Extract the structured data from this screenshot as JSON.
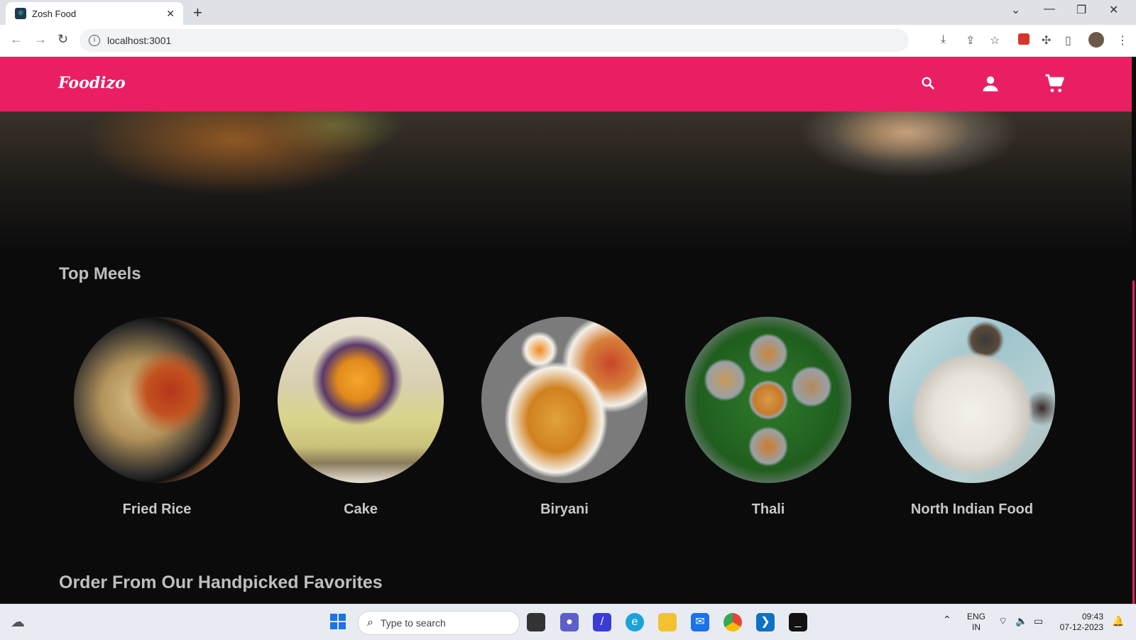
{
  "browser": {
    "tab_title": "Zosh Food",
    "url": "localhost:3001"
  },
  "app": {
    "logo": "Foodizo",
    "brand_color": "#e91e63"
  },
  "top_meals": {
    "title": "Top Meels",
    "items": [
      {
        "name": "Fried Rice"
      },
      {
        "name": "Cake"
      },
      {
        "name": "Biryani"
      },
      {
        "name": "Thali"
      },
      {
        "name": "North Indian Food"
      }
    ]
  },
  "favorites": {
    "title": "Order From Our Handpicked Favorites"
  },
  "taskbar": {
    "search_placeholder": "Type to search",
    "lang_top": "ENG",
    "lang_bottom": "IN",
    "time": "09:43",
    "date": "07-12-2023"
  }
}
